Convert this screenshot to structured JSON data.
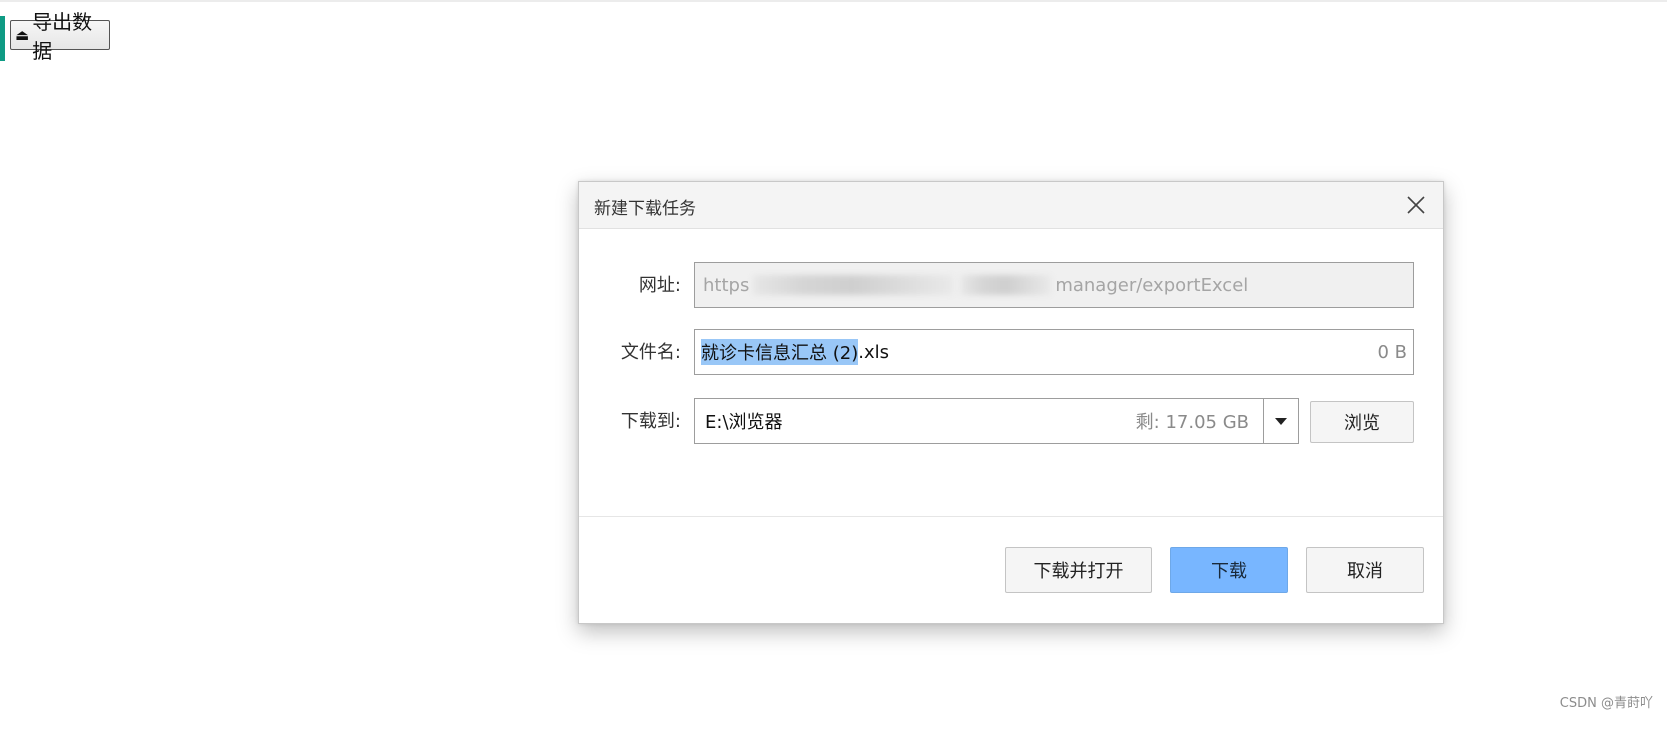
{
  "page": {
    "export_button": {
      "label": "导出数据",
      "icon": "export-upload-icon"
    },
    "watermark": "CSDN @青莳吖"
  },
  "dialog": {
    "title": "新建下载任务",
    "url": {
      "label": "网址:",
      "visible_prefix": "https",
      "visible_suffix": "manager/exportExcel"
    },
    "filename": {
      "label": "文件名:",
      "selected_part": "就诊卡信息汇总 (2)",
      "extension": ".xls",
      "size": "0 B"
    },
    "save_to": {
      "label": "下载到:",
      "path": "E:\\浏览器",
      "free_space": "剩: 17.05 GB"
    },
    "browse_label": "浏览",
    "buttons": {
      "download_and_open": "下载并打开",
      "download": "下载",
      "cancel": "取消"
    }
  },
  "colors": {
    "accent_bar": "#0f9b84",
    "primary_button": "#78b6ff",
    "selection": "#99c7f7"
  }
}
